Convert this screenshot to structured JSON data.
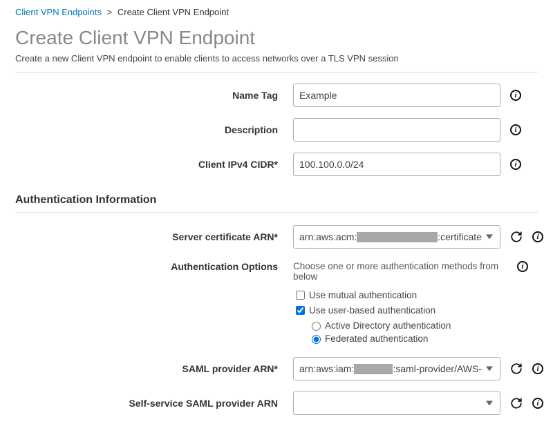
{
  "breadcrumb": {
    "root": "Client VPN Endpoints",
    "current": "Create Client VPN Endpoint"
  },
  "page_title": "Create Client VPN Endpoint",
  "page_subtitle": "Create a new Client VPN endpoint to enable clients to access networks over a TLS VPN session",
  "fields": {
    "name_tag": {
      "label": "Name Tag",
      "value": "Example"
    },
    "description": {
      "label": "Description",
      "value": ""
    },
    "cidr": {
      "label": "Client IPv4 CIDR*",
      "value": "100.100.0.0/24"
    }
  },
  "auth_section_title": "Authentication Information",
  "auth": {
    "server_cert": {
      "label": "Server certificate ARN*",
      "prefix": "arn:aws:acm:",
      "suffix": ":certificate"
    },
    "options_label": "Authentication Options",
    "options_hint": "Choose one or more authentication methods from below",
    "mutual": {
      "label": "Use mutual authentication",
      "checked": false
    },
    "userbased": {
      "label": "Use user-based authentication",
      "checked": true
    },
    "ad": {
      "label": "Active Directory authentication",
      "checked": false
    },
    "fed": {
      "label": "Federated authentication",
      "checked": true
    },
    "saml": {
      "label": "SAML provider ARN*",
      "prefix": "arn:aws:iam:",
      "suffix": ":saml-provider/AWS-"
    },
    "ss_saml": {
      "label": "Self-service SAML provider ARN",
      "value": ""
    }
  }
}
